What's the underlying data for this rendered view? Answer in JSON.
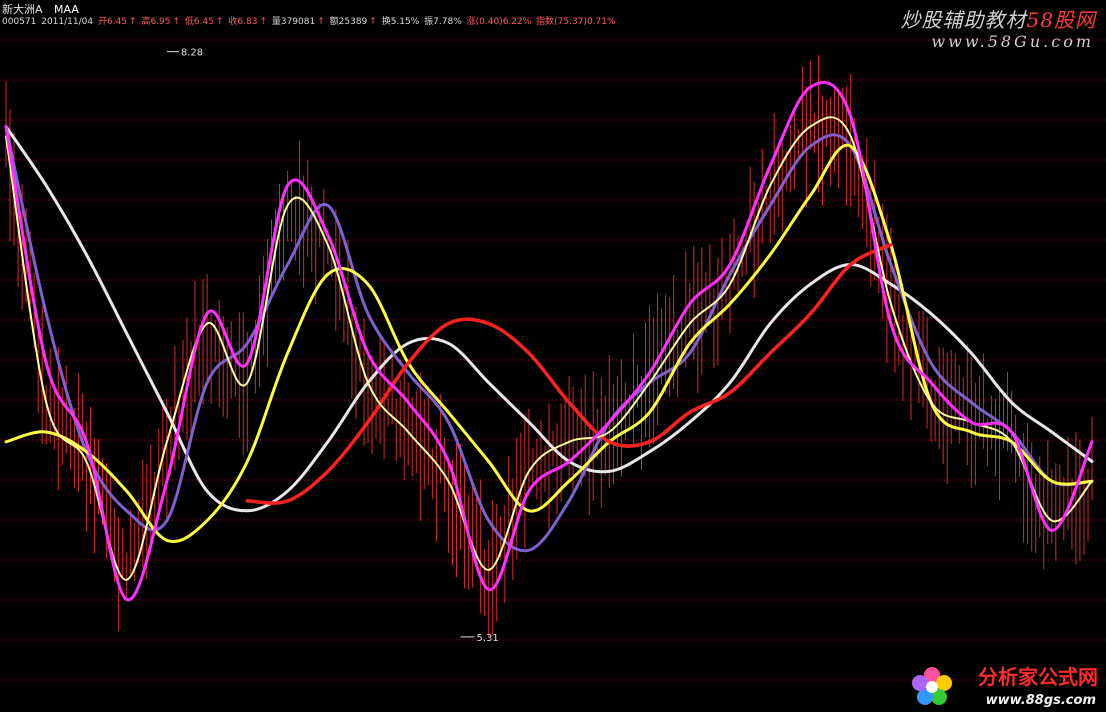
{
  "header": {
    "name": "新大洲A",
    "indicator": "MAA",
    "code": "000571",
    "date": "2011/11/04",
    "open": "开6.45",
    "high": "高6.95",
    "low": "低6.45",
    "close": "收6.83",
    "volume": "量379081",
    "amount": "额25389",
    "turnover": "换5.15%",
    "amplitude": "振7.78%",
    "change": "涨(0.40)6.22%",
    "index": "指数(75.37)0.71%"
  },
  "watermark": {
    "title": "炒股辅助教材",
    "title_accent": "58股网",
    "url": "www.58Gu.com",
    "brand": "分析家公式网",
    "brand_url": "www.88gs.com"
  },
  "colors": {
    "background": "#000000",
    "grid": "#a01818",
    "candle": "#ff3030",
    "ma_fast": "#ffffa0",
    "ma_magenta": "#ff30ff",
    "ma_purple": "#8060d0",
    "ma_yellow": "#ffff40",
    "ma_white": "#e8e8e8",
    "ma_red": "#ff2020"
  },
  "chart_data": {
    "type": "line",
    "title": "",
    "xlabel": "",
    "ylabel": "",
    "ylim": [
      5.0,
      8.4
    ],
    "grid": true,
    "legend": "none",
    "annotations": [
      {
        "label": "8.28",
        "kind": "max",
        "x": 40,
        "y": 8.28
      },
      {
        "label": "5.31",
        "kind": "min",
        "x": 113,
        "y": 5.31
      }
    ],
    "x": [
      0,
      10,
      20,
      30,
      40,
      50,
      60,
      70,
      80,
      90,
      100,
      110,
      120,
      130,
      140,
      150,
      160,
      170,
      180,
      190,
      200,
      210,
      220,
      230,
      240,
      250,
      260,
      270
    ],
    "series": [
      {
        "role": "ma_fast",
        "values": [
          7.85,
          6.5,
          6.2,
          5.6,
          6.3,
          6.9,
          6.6,
          7.5,
          7.3,
          6.6,
          6.35,
          6.1,
          5.65,
          6.15,
          6.3,
          6.35,
          6.6,
          6.9,
          7.1,
          7.6,
          7.9,
          7.85,
          7.0,
          6.5,
          6.4,
          6.3,
          5.9,
          6.1
        ]
      },
      {
        "role": "ma_magenta",
        "values": [
          7.9,
          6.7,
          6.3,
          5.5,
          6.1,
          6.95,
          6.7,
          7.6,
          7.35,
          6.75,
          6.5,
          6.2,
          5.55,
          6.05,
          6.2,
          6.4,
          6.65,
          7.0,
          7.2,
          7.7,
          8.1,
          7.95,
          6.9,
          6.6,
          6.4,
          6.35,
          5.85,
          6.3
        ]
      },
      {
        "role": "ma_purple",
        "values": [
          7.9,
          6.95,
          6.25,
          5.95,
          5.9,
          6.6,
          6.8,
          7.2,
          7.5,
          6.95,
          6.65,
          6.4,
          5.9,
          5.75,
          6.0,
          6.4,
          6.6,
          6.75,
          7.15,
          7.5,
          7.8,
          7.8,
          7.2,
          6.7,
          6.5,
          6.35,
          6.1,
          6.1
        ]
      },
      {
        "role": "ma_yellow",
        "values": [
          6.3,
          6.35,
          6.25,
          6.05,
          5.8,
          5.9,
          6.2,
          6.75,
          7.15,
          7.1,
          6.7,
          6.45,
          6.2,
          5.95,
          6.1,
          6.3,
          6.45,
          6.8,
          7.0,
          7.25,
          7.55,
          7.8,
          7.3,
          6.5,
          6.35,
          6.3,
          6.1,
          6.1
        ]
      },
      {
        "role": "ma_white",
        "values": [
          7.9,
          7.6,
          7.25,
          6.85,
          6.45,
          6.05,
          5.95,
          6.05,
          6.3,
          6.6,
          6.8,
          6.8,
          6.6,
          6.4,
          6.2,
          6.15,
          6.25,
          6.4,
          6.6,
          6.9,
          7.1,
          7.2,
          7.1,
          6.95,
          6.75,
          6.5,
          6.35,
          6.2
        ]
      },
      {
        "role": "ma_red",
        "values": [
          null,
          null,
          null,
          null,
          null,
          null,
          6.0,
          6.0,
          6.15,
          6.4,
          6.7,
          6.9,
          6.9,
          6.75,
          6.5,
          6.3,
          6.3,
          6.45,
          6.55,
          6.75,
          6.95,
          7.2,
          7.3,
          null,
          null,
          null,
          null,
          null
        ]
      }
    ]
  }
}
